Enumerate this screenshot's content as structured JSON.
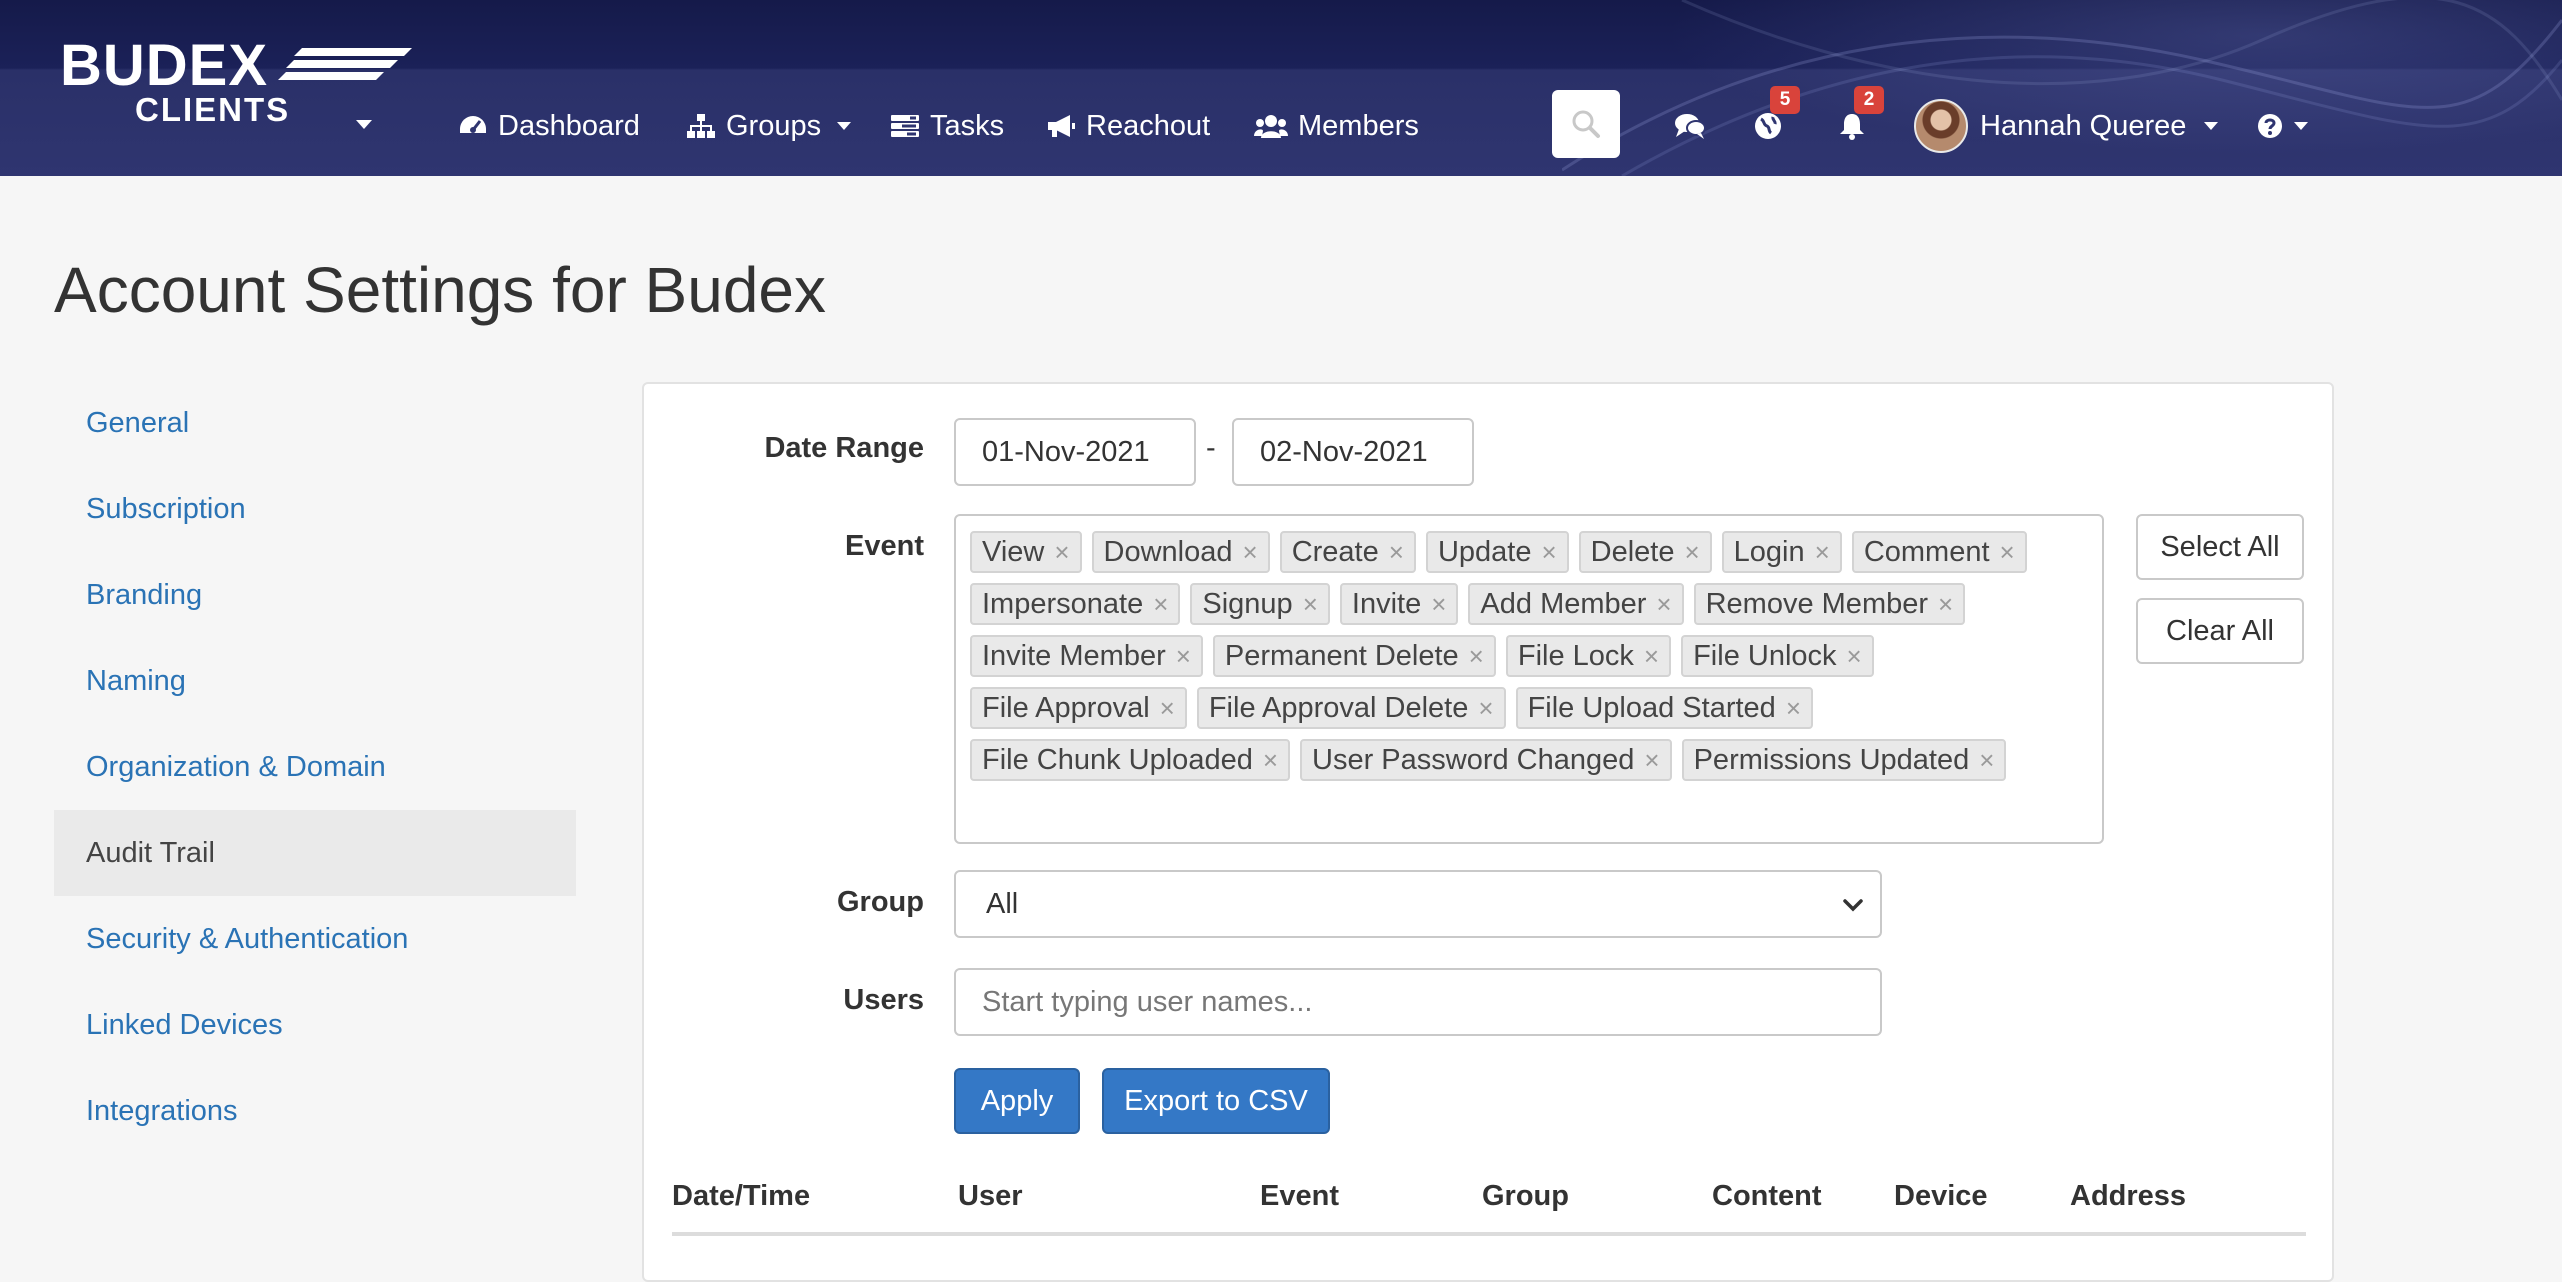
{
  "navbar": {
    "logo": {
      "brand": "BUDEX",
      "sub": "CLIENTS"
    },
    "items": [
      {
        "label": "Dashboard",
        "icon": "dashboard-icon"
      },
      {
        "label": "Groups",
        "icon": "sitemap-icon"
      },
      {
        "label": "Tasks",
        "icon": "tasks-icon"
      },
      {
        "label": "Reachout",
        "icon": "megaphone-icon"
      },
      {
        "label": "Members",
        "icon": "users-icon"
      }
    ],
    "badges": {
      "activity": "5",
      "notifications": "2"
    },
    "user_name": "Hannah Queree"
  },
  "page": {
    "title": "Account Settings for Budex"
  },
  "sidebar": {
    "items": [
      {
        "label": "General"
      },
      {
        "label": "Subscription"
      },
      {
        "label": "Branding"
      },
      {
        "label": "Naming"
      },
      {
        "label": "Organization & Domain"
      },
      {
        "label": "Audit Trail",
        "active": true
      },
      {
        "label": "Security & Authentication"
      },
      {
        "label": "Linked Devices"
      },
      {
        "label": "Integrations"
      }
    ]
  },
  "form": {
    "date_range_label": "Date Range",
    "date_from": "01-Nov-2021",
    "date_separator": "-",
    "date_to": "02-Nov-2021",
    "event_label": "Event",
    "events": [
      "View",
      "Download",
      "Create",
      "Update",
      "Delete",
      "Login",
      "Comment",
      "Impersonate",
      "Signup",
      "Invite",
      "Add Member",
      "Remove Member",
      "Invite Member",
      "Permanent Delete",
      "File Lock",
      "File Unlock",
      "File Approval",
      "File Approval Delete",
      "File Upload Started",
      "File Chunk Uploaded",
      "User Password Changed",
      "Permissions Updated"
    ],
    "tag_remove": "×",
    "select_all": "Select All",
    "clear_all": "Clear All",
    "group_label": "Group",
    "group_value": "All",
    "users_label": "Users",
    "users_placeholder": "Start typing user names...",
    "apply": "Apply",
    "export": "Export to CSV"
  },
  "table": {
    "columns": [
      "Date/Time",
      "User",
      "Event",
      "Group",
      "Content",
      "Device",
      "Address"
    ]
  }
}
